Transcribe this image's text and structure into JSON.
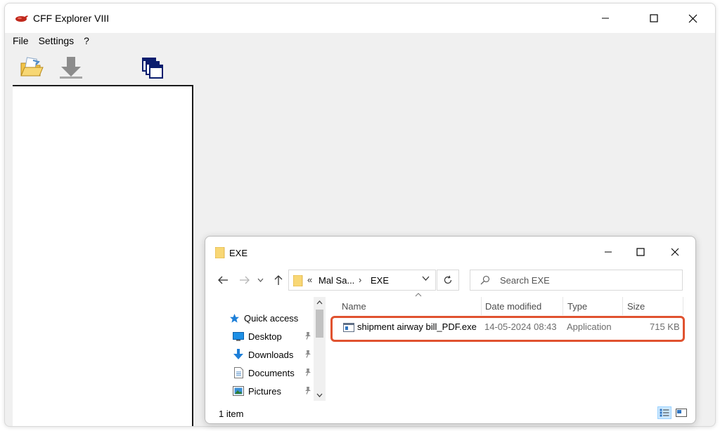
{
  "main_window": {
    "title": "CFF Explorer VIII",
    "menu": [
      "File",
      "Settings",
      "?"
    ],
    "toolbar": [
      "open-folder-icon",
      "download-arrow-icon",
      "windows-icon"
    ]
  },
  "explorer": {
    "title": "EXE",
    "address": {
      "overflow": "«",
      "segments": [
        "Mal Sa...",
        "EXE"
      ],
      "separator": "›"
    },
    "search": {
      "placeholder": "Search EXE"
    },
    "nav_pane": {
      "items": [
        {
          "label": "Quick access",
          "icon": "star-icon",
          "pinned": false
        },
        {
          "label": "Desktop",
          "icon": "desktop-icon",
          "pinned": true
        },
        {
          "label": "Downloads",
          "icon": "download-icon",
          "pinned": true
        },
        {
          "label": "Documents",
          "icon": "document-icon",
          "pinned": true
        },
        {
          "label": "Pictures",
          "icon": "pictures-icon",
          "pinned": true
        }
      ]
    },
    "columns": [
      "Name",
      "Date modified",
      "Type",
      "Size"
    ],
    "files": [
      {
        "name": "shipment airway bill_PDF.exe",
        "date_modified": "14-05-2024 08:43",
        "type": "Application",
        "size": "715 KB"
      }
    ],
    "status": "1 item"
  },
  "colors": {
    "highlight": "#e0522f",
    "accent": "#0078d7",
    "folder": "#f8d775"
  }
}
